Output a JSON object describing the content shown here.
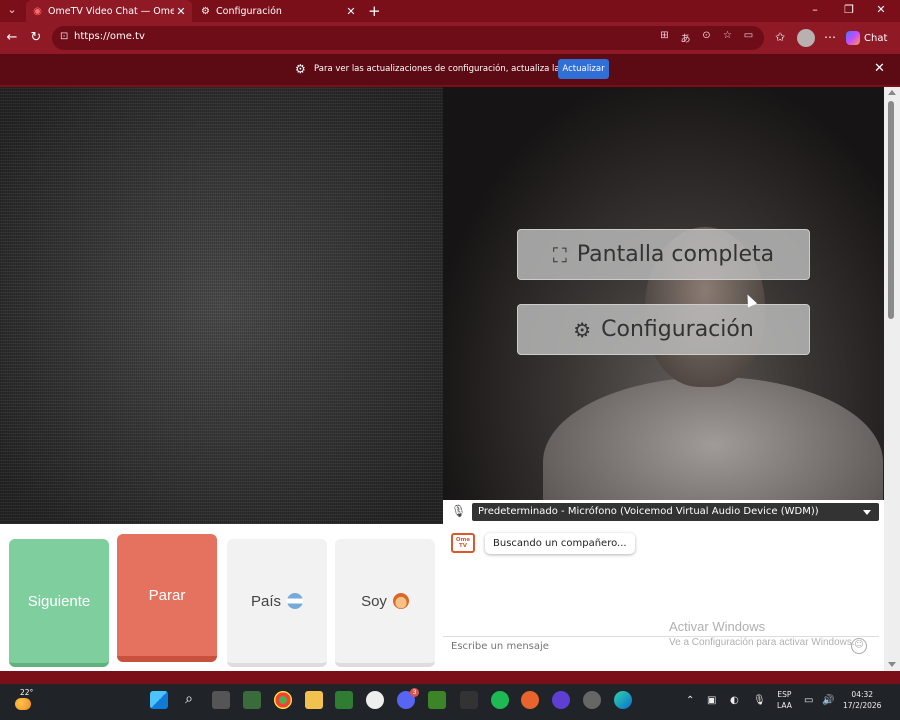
{
  "browser": {
    "tabs": [
      {
        "title": "OmeTV Video Chat — Omegle",
        "active": true
      },
      {
        "title": "Configuración",
        "active": false
      }
    ],
    "new_tab_label": "+",
    "url": "https://ome.tv",
    "chat_button_label": "Chat",
    "accent_color": "#8f1a26"
  },
  "infobar": {
    "message": "Para ver las actualizaciones de configuración, actualiza la página",
    "button_label": "Actualizar"
  },
  "video": {
    "fullscreen_label": "Pantalla completa",
    "settings_label": "Configuración",
    "microphone": "Predeterminado - Micrófono (Voicemod Virtual Audio Device (WDM))"
  },
  "controls": {
    "next_label": "Siguiente",
    "stop_label": "Parar",
    "country_label": "País",
    "me_label": "Soy"
  },
  "chat": {
    "logo_line1": "Ome",
    "logo_line2": "TV",
    "status_message": "Buscando un compañero...",
    "input_placeholder": "Escribe un mensaje"
  },
  "watermark": {
    "title": "Activar Windows",
    "subtitle": "Ve a Configuración para activar Windows."
  },
  "taskbar": {
    "temperature": "22°",
    "lang_line1": "ESP",
    "lang_line2": "LAA",
    "time": "04:32",
    "date": "17/2/2026",
    "discord_badge": "3"
  }
}
